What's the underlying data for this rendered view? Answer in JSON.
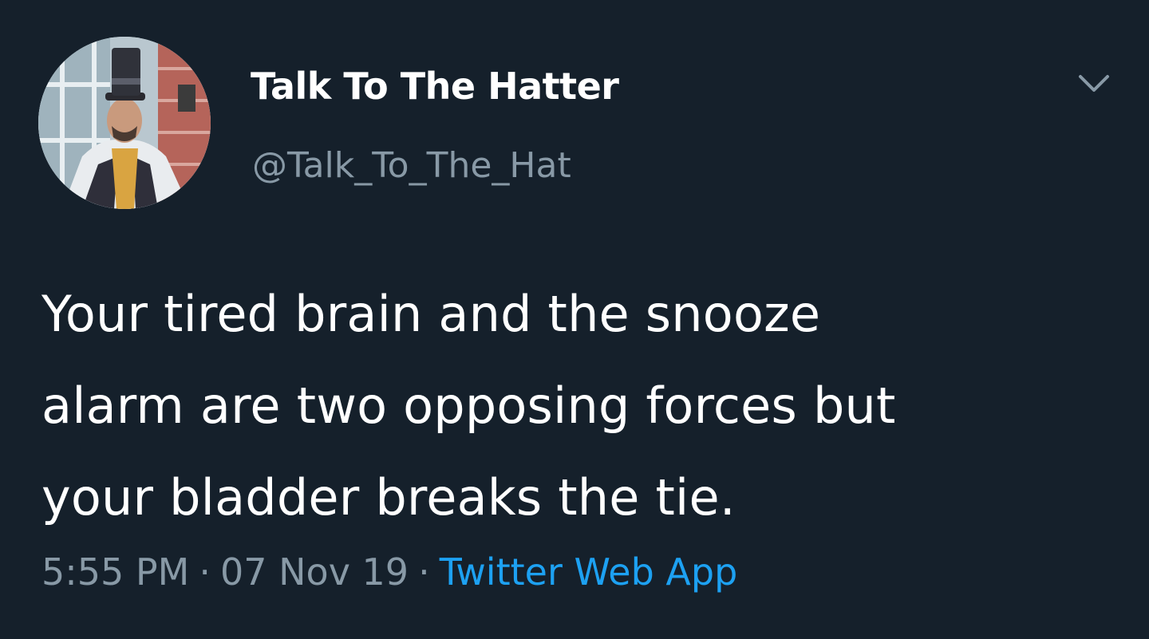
{
  "user": {
    "display_name": "Talk To The Hatter",
    "handle": "@Talk_To_The_Hat",
    "avatar_icon": "profile-photo-man-in-top-hat"
  },
  "tweet": {
    "text_lines": [
      "Your tired brain and the snooze",
      "alarm are two opposing forces but",
      "your bladder breaks the tie."
    ],
    "time": "5:55 PM",
    "separator": "·",
    "date": "07 Nov 19",
    "source": "Twitter Web App"
  },
  "controls": {
    "menu_icon": "chevron-down-icon"
  },
  "colors": {
    "background": "#15202B",
    "primary_text": "#FFFFFF",
    "secondary_text": "#8899A6",
    "accent": "#1DA1F2"
  }
}
